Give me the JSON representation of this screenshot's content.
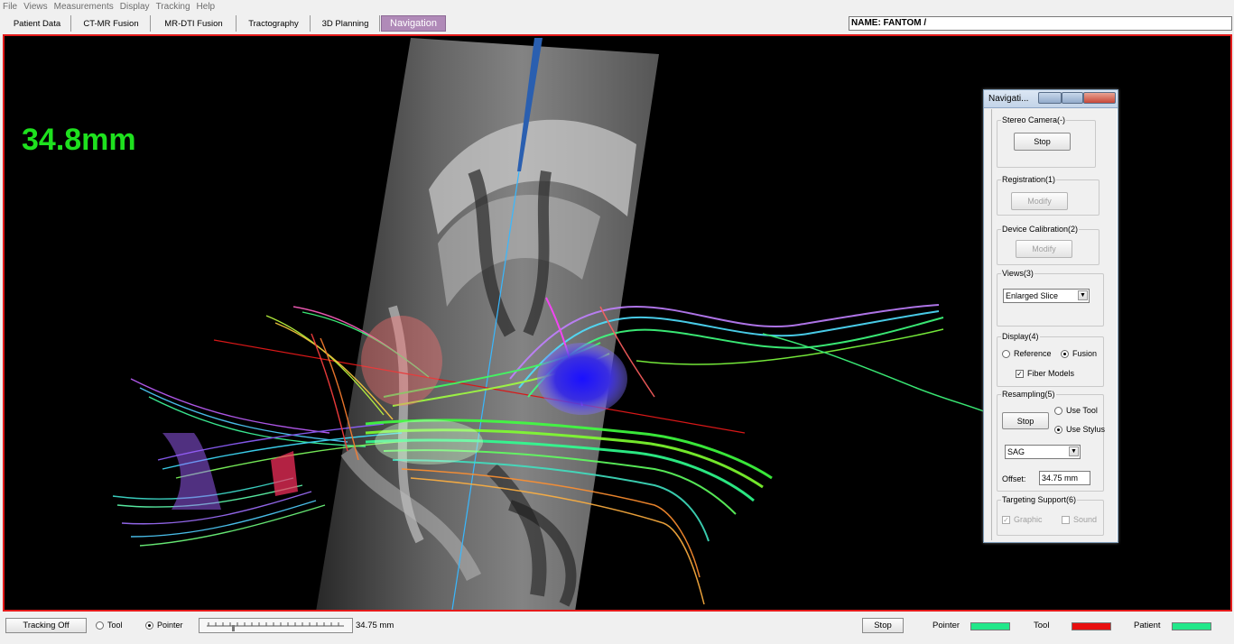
{
  "menu": [
    "File",
    "Views",
    "Measurements",
    "Display",
    "Tracking",
    "Help"
  ],
  "tabs": [
    "Patient Data",
    "CT-MR Fusion",
    "MR-DTI Fusion",
    "Tractography",
    "3D Planning",
    "Navigation"
  ],
  "active_tab": "Navigation",
  "patient_name": "NAME:  FANTOM /",
  "depth_readout": "34.8mm",
  "nav_panel": {
    "title": "Navigati...",
    "stereo_camera": {
      "title": "Stereo Camera(-)",
      "button": "Stop"
    },
    "registration": {
      "title": "Registration(1)",
      "button": "Modify"
    },
    "device_calibration": {
      "title": "Device Calibration(2)",
      "button": "Modify"
    },
    "views": {
      "title": "Views(3)",
      "selected": "Enlarged Slice"
    },
    "display": {
      "title": "Display(4)",
      "reference": "Reference",
      "fusion": "Fusion",
      "fiber_models": "Fiber Models",
      "fusion_selected": true,
      "fiber_models_checked": true
    },
    "resampling": {
      "title": "Resampling(5)",
      "button": "Stop",
      "use_tool": "Use Tool",
      "use_stylus": "Use Stylus",
      "plane": "SAG",
      "offset_label": "Offset:",
      "offset_value": "34.75 mm"
    },
    "targeting": {
      "title": "Targeting Support(6)",
      "graphic": "Graphic",
      "sound": "Sound"
    }
  },
  "statusbar": {
    "tracking_button": "Tracking Off",
    "tool_radio": "Tool",
    "pointer_radio": "Pointer",
    "slider_value": "34.75 mm",
    "stop_button": "Stop",
    "pointer_label": "Pointer",
    "tool_label": "Tool",
    "patient_label": "Patient"
  },
  "colors": {
    "viewport_border": "#e41b1b",
    "depth_text": "#1ee11e",
    "active_tab": "#b08ab8",
    "pointer_indicator": "#22e88a",
    "tool_indicator": "#e81010",
    "patient_indicator": "#22e88a"
  }
}
